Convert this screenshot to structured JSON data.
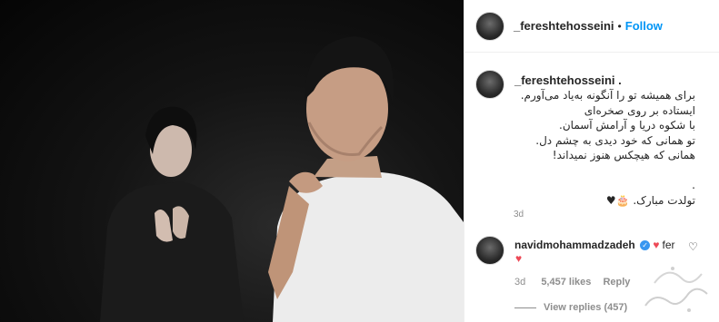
{
  "post": {
    "username": "_fereshtehosseini",
    "separator": "•",
    "follow_label": "Follow"
  },
  "caption": {
    "username": "_fereshtehosseini .",
    "lines": [
      "برای همیشه تو را آنگونه به‌یاد می‌آورم.",
      "ایستاده بر روی صخره‌ای",
      "با شکوه دریا و آرامش آسمان.",
      "تو همانی که خود دیدی به چشم دل.",
      "همانی که هیچکس هنوز نمیداند!",
      "",
      ".",
      "تولدت مبارک. 🎂♥"
    ],
    "time": "3d"
  },
  "comment": {
    "username": "navidmohammadzadeh",
    "verified_glyph": "✓",
    "text_heart": "♥",
    "text": "fer",
    "second_line_heart": "♥",
    "like_icon": "heart-outline-icon",
    "time": "3d",
    "likes": "5,457 likes",
    "reply": "Reply",
    "view_replies": "View replies (457)"
  }
}
